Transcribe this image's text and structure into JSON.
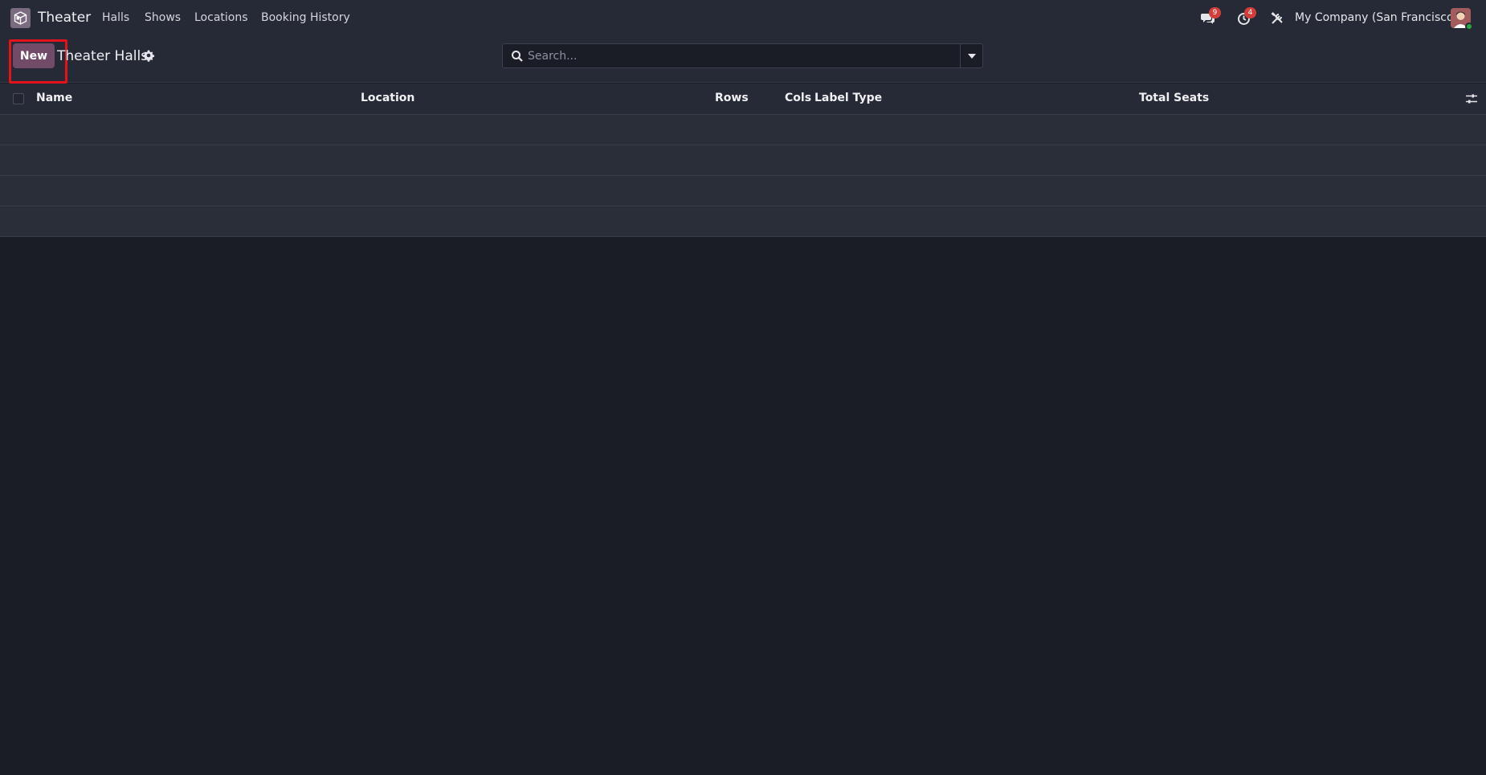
{
  "navbar": {
    "app_name": "Theater",
    "menu": [
      {
        "label": "Halls"
      },
      {
        "label": "Shows"
      },
      {
        "label": "Locations"
      },
      {
        "label": "Booking History"
      }
    ],
    "messages_count": "9",
    "activities_count": "4",
    "company": "My Company (San Francisco)",
    "user_status": "online"
  },
  "control_panel": {
    "new_label": "New",
    "title": "Theater Halls",
    "search_placeholder": "Search..."
  },
  "list": {
    "columns": [
      "Name",
      "Location",
      "Rows",
      "Cols",
      "Label Type",
      "Total Seats"
    ],
    "rows": []
  },
  "colors": {
    "brand": "#714b67",
    "highlight": "#e3121b",
    "badge": "#d23f3a"
  }
}
